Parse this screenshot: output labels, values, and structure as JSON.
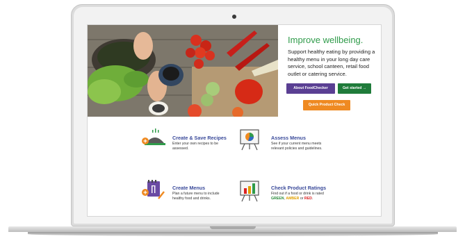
{
  "hero": {
    "title": "Improve wellbeing.",
    "description": "Support healthy eating by providing a healthy menu in your long day care service, school canteen, retail food outlet or catering service.",
    "buttons": {
      "about": "About FoodChecker",
      "get_started": "Get started →",
      "quick_check": "Quick Product Check"
    }
  },
  "features": [
    {
      "title": "Create & Save Recipes",
      "description": "Enter your own recipes to be assessed."
    },
    {
      "title": "Assess Menus",
      "description": "See if your current menu meets relevant policies and guidelines."
    },
    {
      "title": "Create Menus",
      "description": "Plan a future menu to include healthy food and drinks."
    },
    {
      "title": "Check Product Ratings",
      "description_prefix": "Find out if a food or drink is rated",
      "rating_green": "GREEN",
      "sep1": ",",
      "rating_amber": "AMBER",
      "sep2": "or",
      "rating_red": "RED",
      "end": "."
    }
  ],
  "colors": {
    "title_green": "#2f9b4a",
    "about_purple": "#5a3f93",
    "start_green": "#1f7b3a",
    "quick_orange": "#ef8a22",
    "feature_blue": "#3a4a9a"
  }
}
